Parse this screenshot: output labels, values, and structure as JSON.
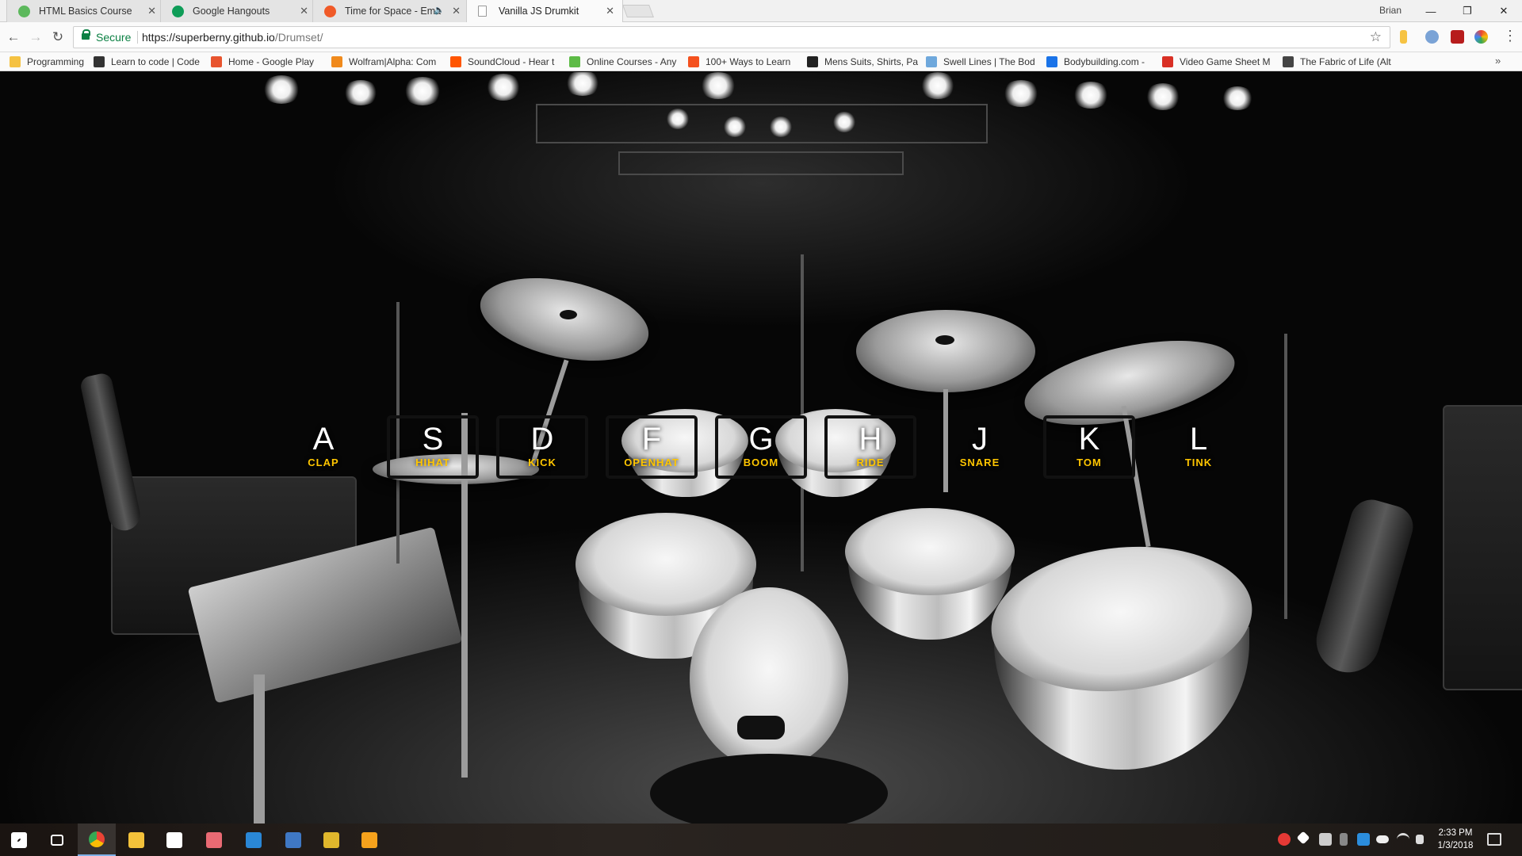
{
  "browser": {
    "tabs": [
      {
        "title": "HTML Basics Course",
        "icon_color": "#5cb85c",
        "active": false
      },
      {
        "title": "Google Hangouts",
        "icon_color": "#0f9d58",
        "active": false
      },
      {
        "title": "Time for Space - Ema",
        "icon_color": "#f05a28",
        "active": false
      },
      {
        "title": "Vanilla JS Drumkit",
        "icon_color": "#9e9e9e",
        "active": true
      }
    ],
    "user_name": "Brian",
    "secure_label": "Secure",
    "url_host": "https://superberny.github.io",
    "url_path": "/Drumset/",
    "bookmarks": [
      {
        "label": "Programming",
        "icon": "folder-icon",
        "color": "#f5c242"
      },
      {
        "label": "Learn to code | Code",
        "icon": "codecademy-icon",
        "color": "#333333"
      },
      {
        "label": "Home - Google Play",
        "icon": "google-play-icon",
        "color": "#e8542e"
      },
      {
        "label": "Wolfram|Alpha: Com",
        "icon": "wolfram-icon",
        "color": "#f08a1c"
      },
      {
        "label": "SoundCloud - Hear t",
        "icon": "soundcloud-icon",
        "color": "#ff5500"
      },
      {
        "label": "Online Courses - Any",
        "icon": "udemy-icon",
        "color": "#5dbb46"
      },
      {
        "label": "100+ Ways to Learn",
        "icon": "learn-icon",
        "color": "#f4511e"
      },
      {
        "label": "Mens Suits, Shirts, Pa",
        "icon": "suits-icon",
        "color": "#222222"
      },
      {
        "label": "Swell Lines | The Bod",
        "icon": "mail-icon",
        "color": "#6fa8dc"
      },
      {
        "label": "Bodybuilding.com - ",
        "icon": "bodybuilding-icon",
        "color": "#1a73e8"
      },
      {
        "label": "Video Game Sheet M",
        "icon": "mario-icon",
        "color": "#d93025"
      },
      {
        "label": "The Fabric of Life (Alt",
        "icon": "fabric-icon",
        "color": "#444444"
      }
    ]
  },
  "drumkit": {
    "keys": [
      {
        "letter": "A",
        "sound": "CLAP"
      },
      {
        "letter": "S",
        "sound": "HIHAT"
      },
      {
        "letter": "D",
        "sound": "KICK"
      },
      {
        "letter": "F",
        "sound": "OPENHAT"
      },
      {
        "letter": "G",
        "sound": "BOOM"
      },
      {
        "letter": "H",
        "sound": "RIDE"
      },
      {
        "letter": "J",
        "sound": "SNARE"
      },
      {
        "letter": "K",
        "sound": "TOM"
      },
      {
        "letter": "L",
        "sound": "TINK"
      }
    ]
  },
  "taskbar": {
    "apps": [
      {
        "name": "start",
        "color": "#ffffff"
      },
      {
        "name": "task-view",
        "color": "#ffffff"
      },
      {
        "name": "chrome",
        "color": "#e94235"
      },
      {
        "name": "file-explorer",
        "color": "#f3c13a"
      },
      {
        "name": "slack",
        "color": "#ffffff"
      },
      {
        "name": "gitkraken",
        "color": "#e96a73"
      },
      {
        "name": "vscode",
        "color": "#2a87d6"
      },
      {
        "name": "sourcetree",
        "color": "#3f78c4"
      },
      {
        "name": "git-extensions",
        "color": "#e0b72c"
      },
      {
        "name": "media-player",
        "color": "#f6a21c"
      }
    ],
    "time": "2:33 PM",
    "date": "1/3/2018"
  }
}
